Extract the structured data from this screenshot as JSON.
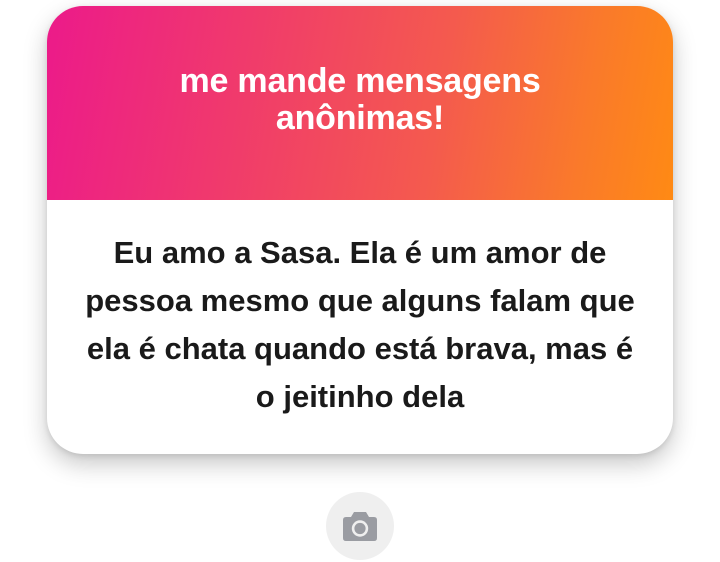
{
  "card": {
    "title": "me mande mensagens anônimas!",
    "message": "Eu amo a Sasa. Ela é um amor de pessoa mesmo que alguns falam que ela é chata quando está brava, mas é o jeitinho dela"
  },
  "colors": {
    "gradient_start": "#ec1a8a",
    "gradient_end": "#ff8a14",
    "title_text": "#ffffff",
    "message_text": "#1a1a1a",
    "camera_button_bg": "#efefef",
    "camera_icon": "#9a9ca2"
  },
  "icons": {
    "camera_button": "camera-icon"
  }
}
